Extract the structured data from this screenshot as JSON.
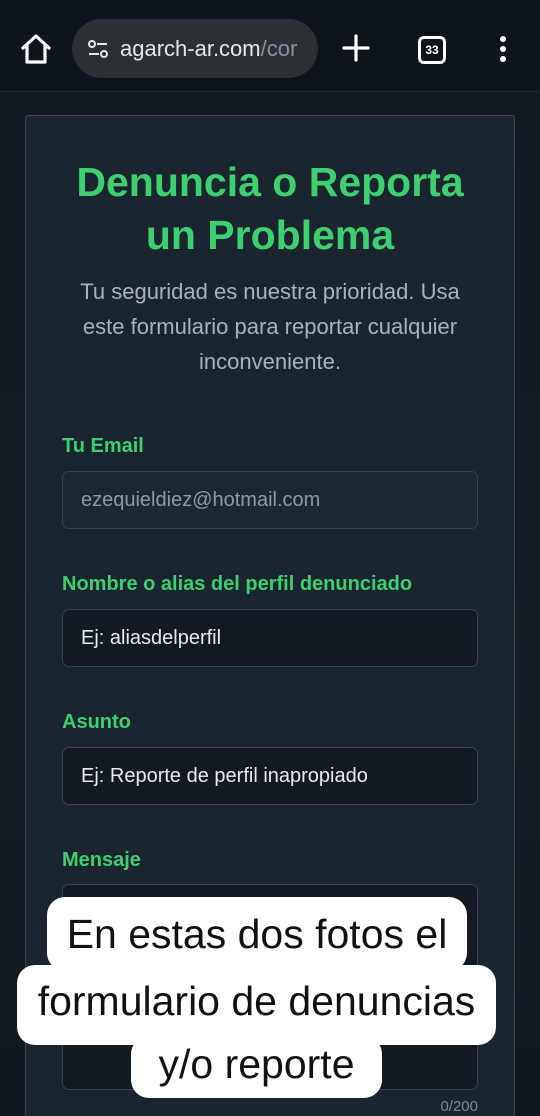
{
  "browser": {
    "url_host": "agarch-ar.com",
    "url_path": "/cor",
    "tab_count": "33"
  },
  "form": {
    "title": "Denuncia o Reporta un Problema",
    "subtitle": "Tu seguridad es nuestra prioridad. Usa este formulario para reportar cualquier inconveniente.",
    "email": {
      "label": "Tu Email",
      "value": "ezequieldiez@hotmail.com"
    },
    "alias": {
      "label": "Nombre o alias del perfil denunciado",
      "placeholder": "Ej: aliasdelperfil"
    },
    "subject": {
      "label": "Asunto",
      "placeholder": "Ej: Reporte de perfil inapropiado"
    },
    "message": {
      "label": "Mensaje",
      "counter": "0/200"
    }
  },
  "caption": {
    "line1": "En estas dos fotos el",
    "line2": "formulario de denuncias",
    "line3": "y/o reporte"
  },
  "colors": {
    "accent": "#3ecf71",
    "card": "#1b2530",
    "input": "#121920"
  },
  "icons": [
    "home-icon",
    "site-settings-icon",
    "new-tab-icon",
    "tab-switcher-icon",
    "more-menu-icon"
  ]
}
